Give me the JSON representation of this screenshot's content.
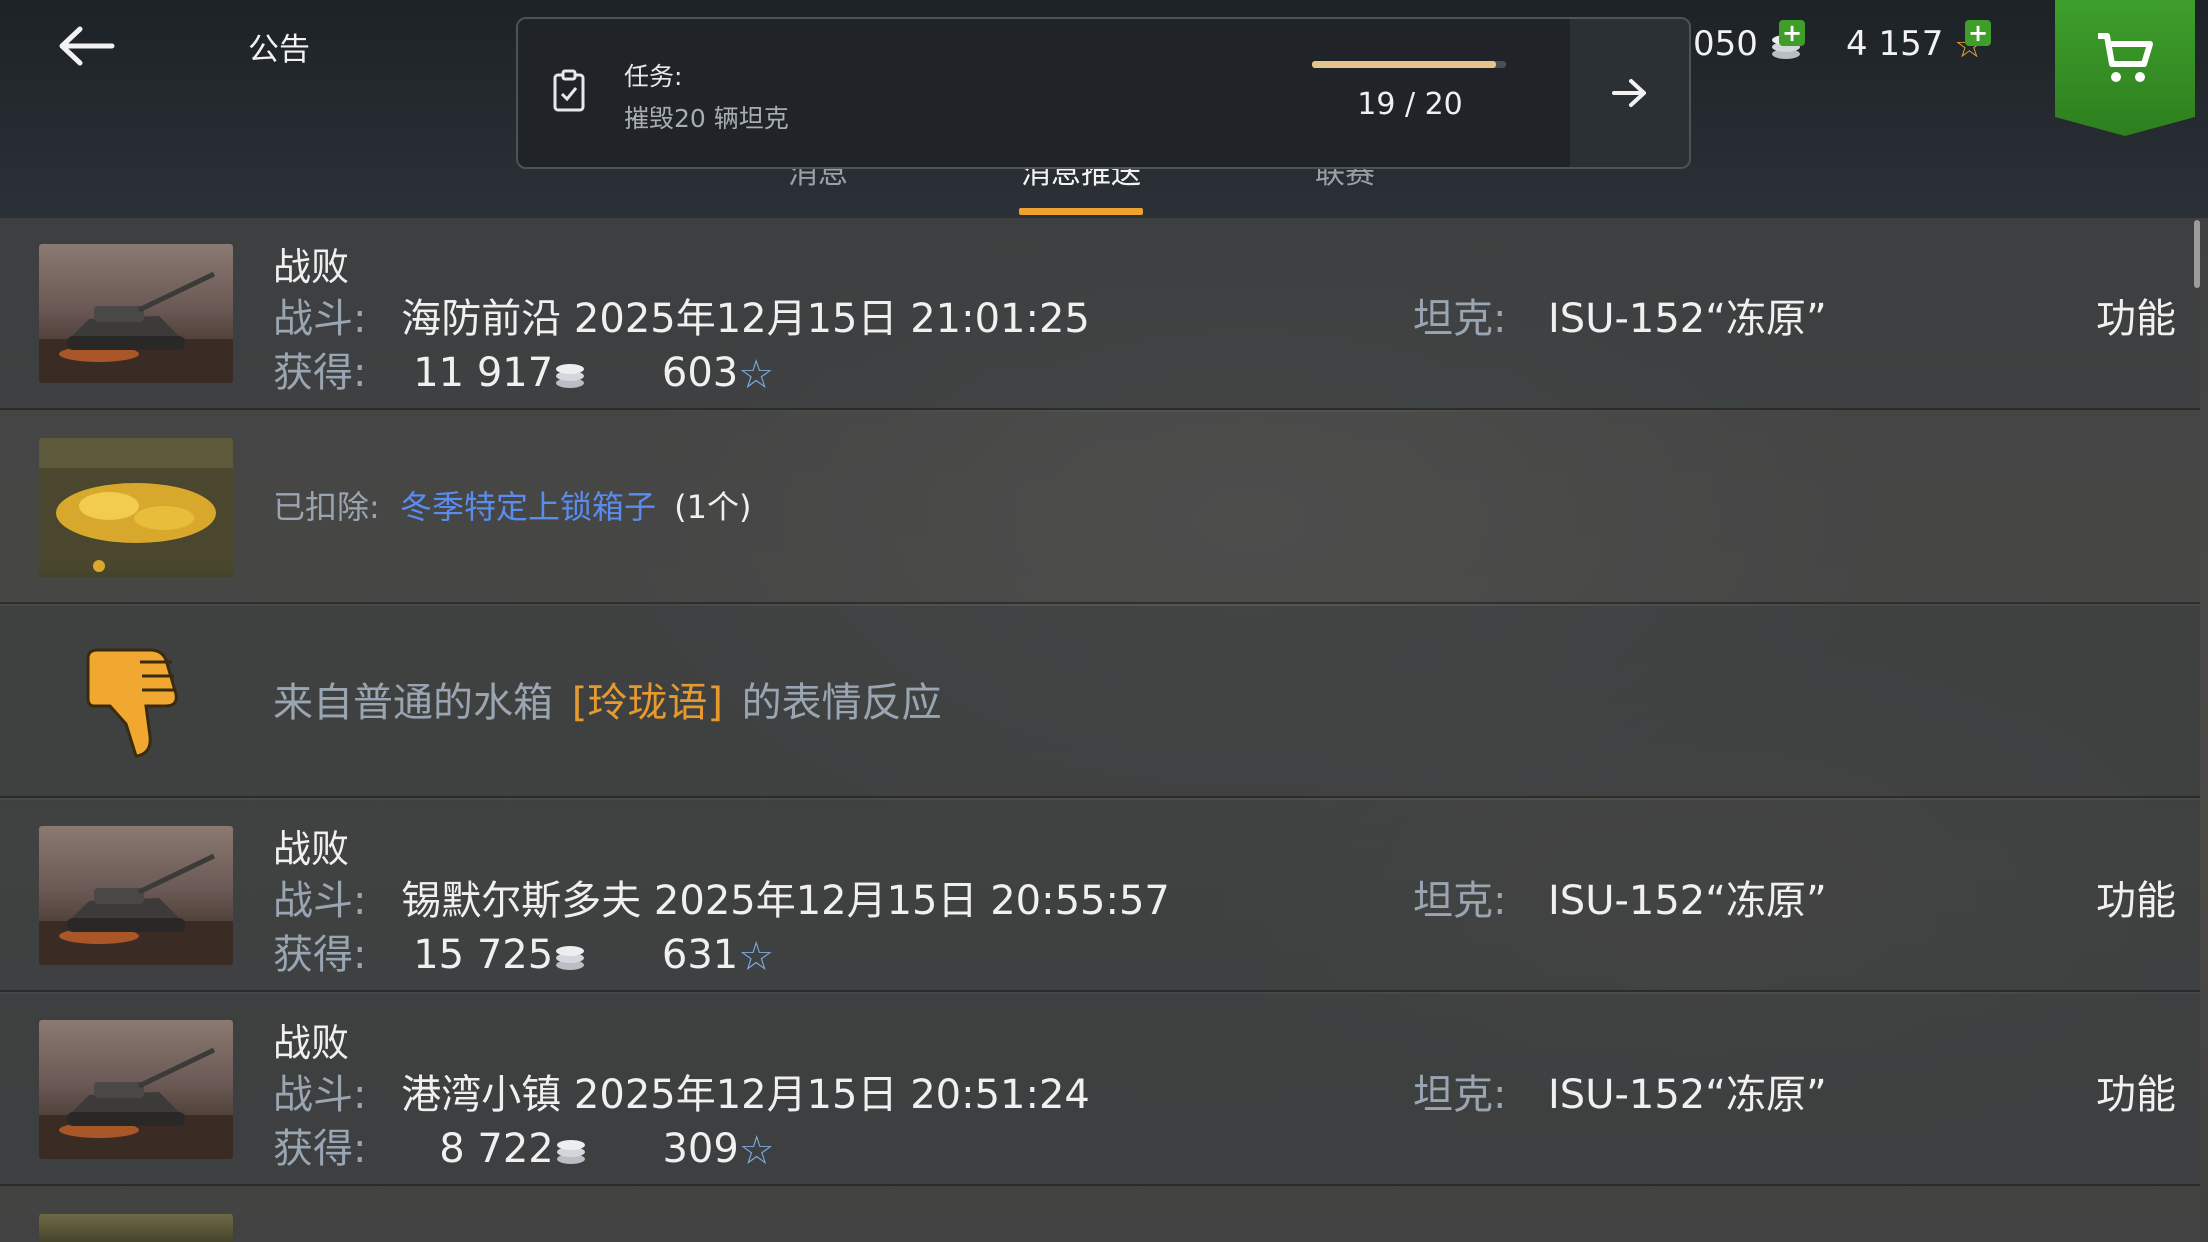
{
  "header": {
    "back_icon": "arrow-left-icon",
    "title": "公告",
    "tabs": [
      {
        "label": "消息",
        "active": false
      },
      {
        "label": "消息推送",
        "active": true
      },
      {
        "label": "联赛",
        "active": false
      }
    ]
  },
  "mission": {
    "icon": "clipboard-check-icon",
    "label": "任务:",
    "description": "摧毁20 辆坦克",
    "progress_text": "19 / 20",
    "progress_fraction": 0.95,
    "go_icon": "arrow-right-icon"
  },
  "currency": {
    "silver": "050",
    "silver_icon": "silver-coin-icon",
    "xp": "4 157",
    "xp_icon": "star-icon",
    "plus_icon": "plus-icon",
    "shop_icon": "cart-icon",
    "shop_color": "#3e9e2b"
  },
  "colors": {
    "accent": "#f0a22e",
    "link": "#5a8cf0",
    "highlight": "#e69a2e",
    "label": "#9aa5b2"
  },
  "rows": [
    {
      "type": "battle",
      "status": "战败",
      "battle_label": "战斗:",
      "battle_value": "海防前沿 2025年12月15日 21:01:25",
      "tank_label": "坦克:",
      "tank_value": "ISU-152“冻原”",
      "reward_label": "获得:",
      "silver": "11 917",
      "xp": "603",
      "action": "功能"
    },
    {
      "type": "deduction",
      "label": "已扣除:",
      "item": "冬季特定上锁箱子",
      "count": "(1个)"
    },
    {
      "type": "reaction",
      "icon": "thumbs-down-icon",
      "prefix": "来自普通的水箱",
      "tag": "[玲珑语]",
      "suffix": "的表情反应"
    },
    {
      "type": "battle",
      "status": "战败",
      "battle_label": "战斗:",
      "battle_value": "锡默尔斯多夫 2025年12月15日 20:55:57",
      "tank_label": "坦克:",
      "tank_value": "ISU-152“冻原”",
      "reward_label": "获得:",
      "silver": "15 725",
      "xp": "631",
      "action": "功能"
    },
    {
      "type": "battle",
      "status": "战败",
      "battle_label": "战斗:",
      "battle_value": "港湾小镇 2025年12月15日 20:51:24",
      "tank_label": "坦克:",
      "tank_value": "ISU-152“冻原”",
      "reward_label": "获得:",
      "silver": "8 722",
      "xp": "309",
      "action": "功能"
    }
  ]
}
